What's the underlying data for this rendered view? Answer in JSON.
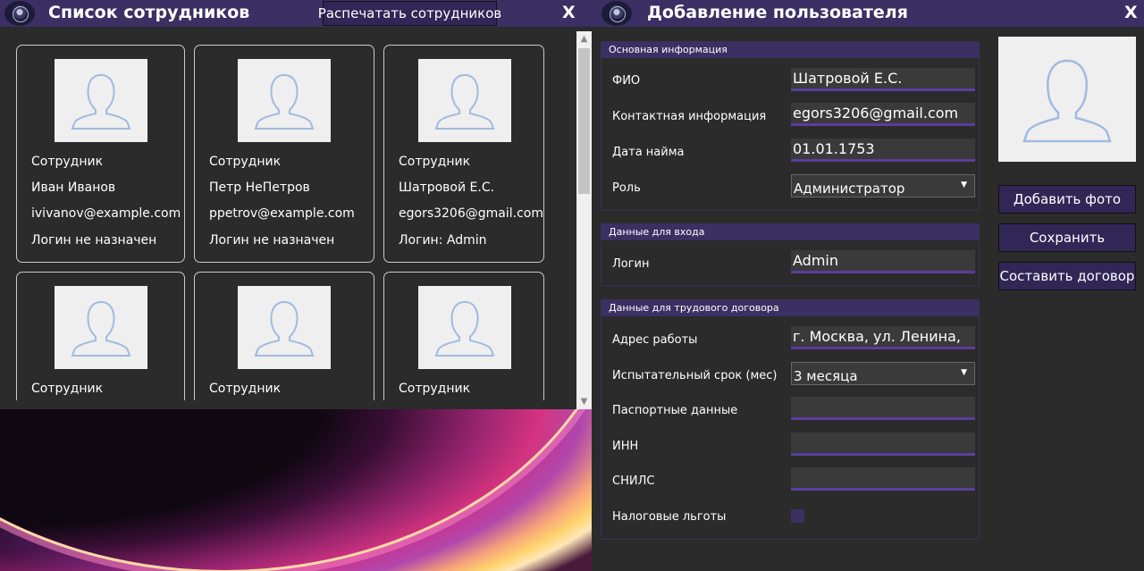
{
  "employee_list": {
    "title": "Список сотрудников",
    "print_button": "Распечатать сотрудников",
    "close": "X",
    "cards": [
      {
        "role": "Сотрудник",
        "name": "Иван Иванов",
        "email": "ivivanov@example.com",
        "login": "Логин не назначен"
      },
      {
        "role": "Сотрудник",
        "name": "Петр НеПетров",
        "email": "ppetrov@example.com",
        "login": "Логин не назначен"
      },
      {
        "role": "Сотрудник",
        "name": "Шатровой Е.С.",
        "email": "egors3206@gmail.com",
        "login": "Логин: Admin"
      },
      {
        "role": "Сотрудник"
      },
      {
        "role": "Сотрудник"
      },
      {
        "role": "Сотрудник"
      }
    ],
    "scroll_up_icon": "chevron-up-icon",
    "scroll_down_icon": "chevron-down-icon"
  },
  "add_user": {
    "title": "Добавление пользователя",
    "close": "X",
    "basic": {
      "header": "Основная информация",
      "fio_label": "ФИО",
      "fio_value": "Шатровой Е.С.",
      "contact_label": "Контактная информация",
      "contact_value": "egors3206@gmail.com",
      "hire_label": "Дата найма",
      "hire_value": "01.01.1753",
      "role_label": "Роль",
      "role_value": "Администратор"
    },
    "login_section": {
      "header": "Данные для входа",
      "login_label": "Логин",
      "login_value": "Admin"
    },
    "contract": {
      "header": "Данные для трудового договора",
      "address_label": "Адрес работы",
      "address_value": "г. Москва, ул. Ленина,",
      "probation_label": "Испытательный срок (мес)",
      "probation_value": "3 месяца",
      "passport_label": "Паспортные данные",
      "passport_value": "",
      "inn_label": "ИНН",
      "inn_value": "",
      "snils_label": "СНИЛС",
      "snils_value": "",
      "tax_label": "Налоговые льготы"
    },
    "buttons": {
      "add_photo": "Добавить фото",
      "save": "Сохранить",
      "contract": "Составить договор"
    }
  },
  "colors": {
    "accent": "#3c2f63",
    "button": "#312656",
    "underline": "#5b3d9e",
    "background": "#2b2b2b"
  }
}
